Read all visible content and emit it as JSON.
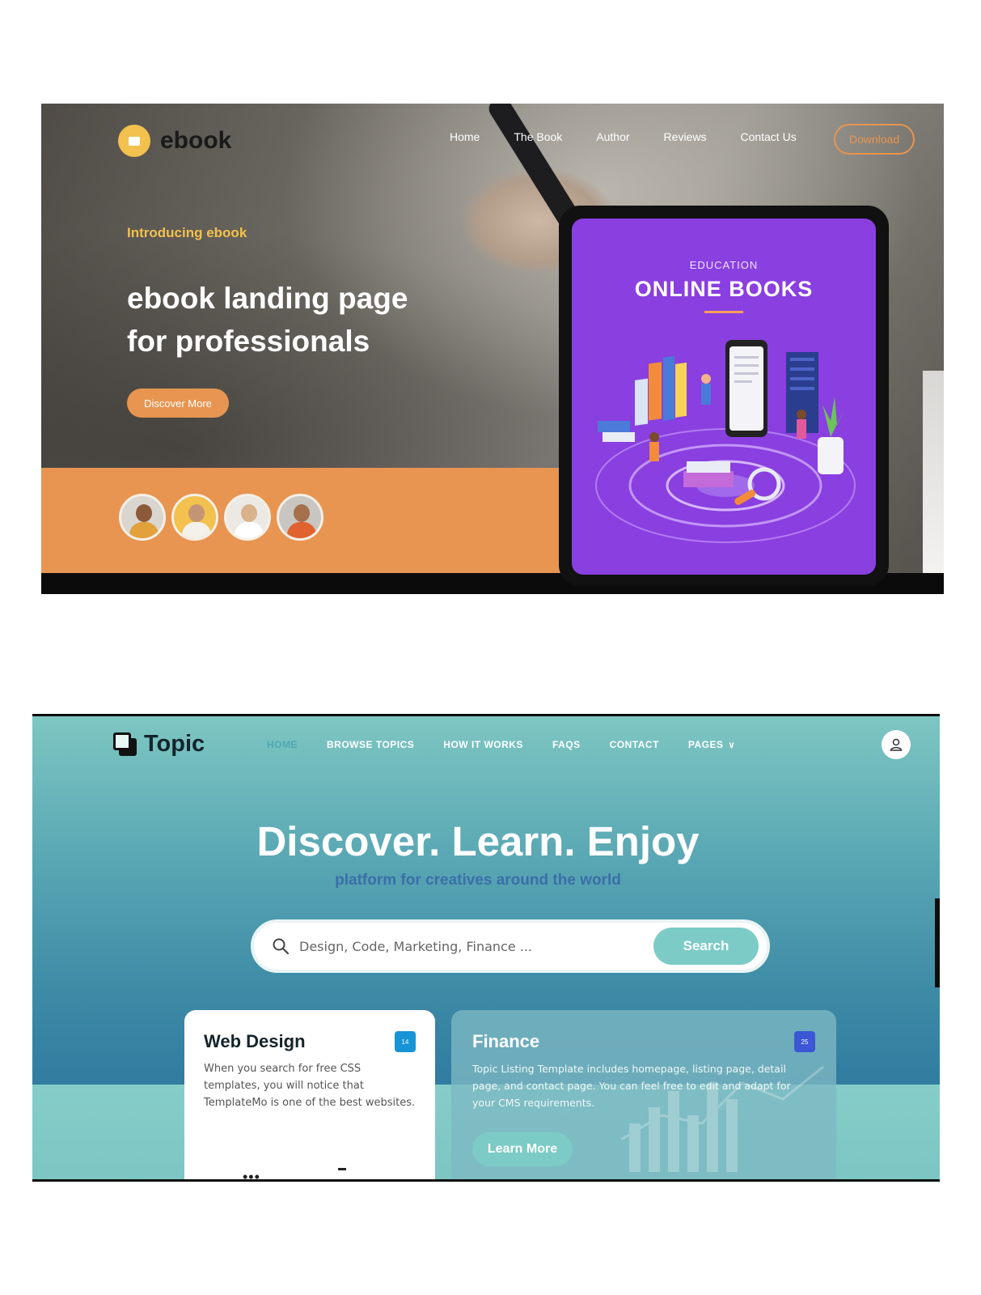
{
  "ebook": {
    "logo_text": "ebook",
    "nav": [
      "Home",
      "The Book",
      "Author",
      "Reviews",
      "Contact Us"
    ],
    "download_label": "Download",
    "intro": "Introducing ebook",
    "headline_line1": "ebook landing page",
    "headline_line2": "for professionals",
    "discover_label": "Discover More",
    "tablet": {
      "eyebrow": "EDUCATION",
      "title": "ONLINE BOOKS"
    },
    "colors": {
      "accent": "#e79550",
      "logo": "#f2c14e",
      "tablet_screen": "#8a3fe0"
    }
  },
  "topic": {
    "logo_text": "Topic",
    "nav": [
      "HOME",
      "BROWSE TOPICS",
      "HOW IT WORKS",
      "FAQS",
      "CONTACT",
      "PAGES"
    ],
    "hero": "Discover. Learn. Enjoy",
    "subtitle": "platform for creatives around the world",
    "search": {
      "placeholder": "Design, Code, Marketing, Finance ...",
      "button": "Search"
    },
    "cards": [
      {
        "title": "Web Design",
        "badge": "14",
        "text": "When you search for free CSS templates, you will notice that TemplateMo is one of the best websites."
      },
      {
        "title": "Finance",
        "badge": "25",
        "text": "Topic Listing Template includes homepage, listing page, detail page, and contact page. You can feel free to edit and adapt for your CMS requirements.",
        "button": "Learn More"
      }
    ],
    "colors": {
      "accent": "#7ccbc6",
      "badge_blue": "#1794d6",
      "badge_indigo": "#3b57d6"
    }
  }
}
